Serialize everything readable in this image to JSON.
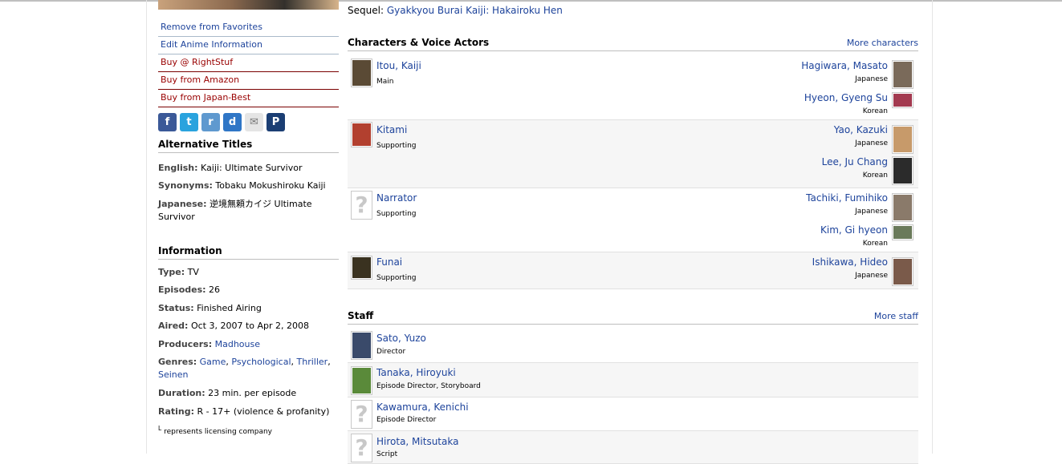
{
  "left": {
    "actions": [
      {
        "label": "Remove from Favorites",
        "type": "normal"
      },
      {
        "label": "Edit Anime Information",
        "type": "normal"
      },
      {
        "label": "Buy @ RightStuf",
        "type": "buy"
      },
      {
        "label": "Buy from Amazon",
        "type": "buy"
      },
      {
        "label": "Buy from Japan-Best",
        "type": "buy"
      }
    ],
    "share_icons": [
      {
        "name": "facebook-icon",
        "glyph": "f"
      },
      {
        "name": "twitter-icon",
        "glyph": "t"
      },
      {
        "name": "reddit-icon",
        "glyph": "r"
      },
      {
        "name": "digg-icon",
        "glyph": "d"
      },
      {
        "name": "mail-icon",
        "glyph": "✉"
      },
      {
        "name": "pinterest-icon",
        "glyph": "P"
      }
    ],
    "alt_titles": {
      "heading": "Alternative Titles",
      "english_label": "English:",
      "english": "Kaiji: Ultimate Survivor",
      "synonyms_label": "Synonyms:",
      "synonyms": "Tobaku Mokushiroku Kaiji",
      "japanese_label": "Japanese:",
      "japanese": "逆境無頼カイジ Ultimate Survivor"
    },
    "information": {
      "heading": "Information",
      "type_label": "Type:",
      "type": "TV",
      "episodes_label": "Episodes:",
      "episodes": "26",
      "status_label": "Status:",
      "status": "Finished Airing",
      "aired_label": "Aired:",
      "aired": "Oct 3, 2007 to Apr 2, 2008",
      "producers_label": "Producers:",
      "producers": "Madhouse",
      "genres_label": "Genres:",
      "genres": [
        "Game",
        "Psychological",
        "Thriller",
        "Seinen"
      ],
      "duration_label": "Duration:",
      "duration": "23 min. per episode",
      "rating_label": "Rating:",
      "rating": "R - 17+ (violence & profanity)",
      "note_mark": "L",
      "note": "represents licensing company"
    }
  },
  "main": {
    "sequel_label": "Sequel:",
    "sequel": "Gyakkyou Burai Kaiji: Hakairoku Hen",
    "characters_heading": "Characters & Voice Actors",
    "more_characters": "More characters",
    "characters": [
      {
        "name": "Itou, Kaiji",
        "role": "Main",
        "thumb_color": "#5a4a35",
        "actors": [
          {
            "name": "Hagiwara, Masato",
            "lang": "Japanese",
            "thumb_color": "#7a6a5a"
          },
          {
            "name": "Hyeon, Gyeng Su",
            "lang": "Korean",
            "thumb_color": "#a33a50"
          }
        ]
      },
      {
        "name": "Kitami",
        "role": "Supporting",
        "thumb_color": "#b2402f",
        "actors": [
          {
            "name": "Yao, Kazuki",
            "lang": "Japanese",
            "thumb_color": "#c79a6a"
          },
          {
            "name": "Lee, Ju Chang",
            "lang": "Korean",
            "thumb_color": "#2b2b2b"
          }
        ]
      },
      {
        "name": "Narrator",
        "role": "Supporting",
        "thumb_color": "",
        "actors": [
          {
            "name": "Tachiki, Fumihiko",
            "lang": "Japanese",
            "thumb_color": "#8a7a6a"
          },
          {
            "name": "Kim, Gi hyeon",
            "lang": "Korean",
            "thumb_color": "#6a7a5a"
          }
        ]
      },
      {
        "name": "Funai",
        "role": "Supporting",
        "thumb_color": "#3a3220",
        "actors": [
          {
            "name": "Ishikawa, Hideo",
            "lang": "Japanese",
            "thumb_color": "#7a5a4a"
          }
        ]
      }
    ],
    "staff_heading": "Staff",
    "more_staff": "More staff",
    "staff": [
      {
        "name": "Sato, Yuzo",
        "role": "Director",
        "thumb_color": "#3a4a6a"
      },
      {
        "name": "Tanaka, Hiroyuki",
        "role": "Episode Director, Storyboard",
        "thumb_color": "#5a8a3a"
      },
      {
        "name": "Kawamura, Kenichi",
        "role": "Episode Director",
        "thumb_color": ""
      },
      {
        "name": "Hirota, Mitsutaka",
        "role": "Script",
        "thumb_color": ""
      }
    ]
  }
}
